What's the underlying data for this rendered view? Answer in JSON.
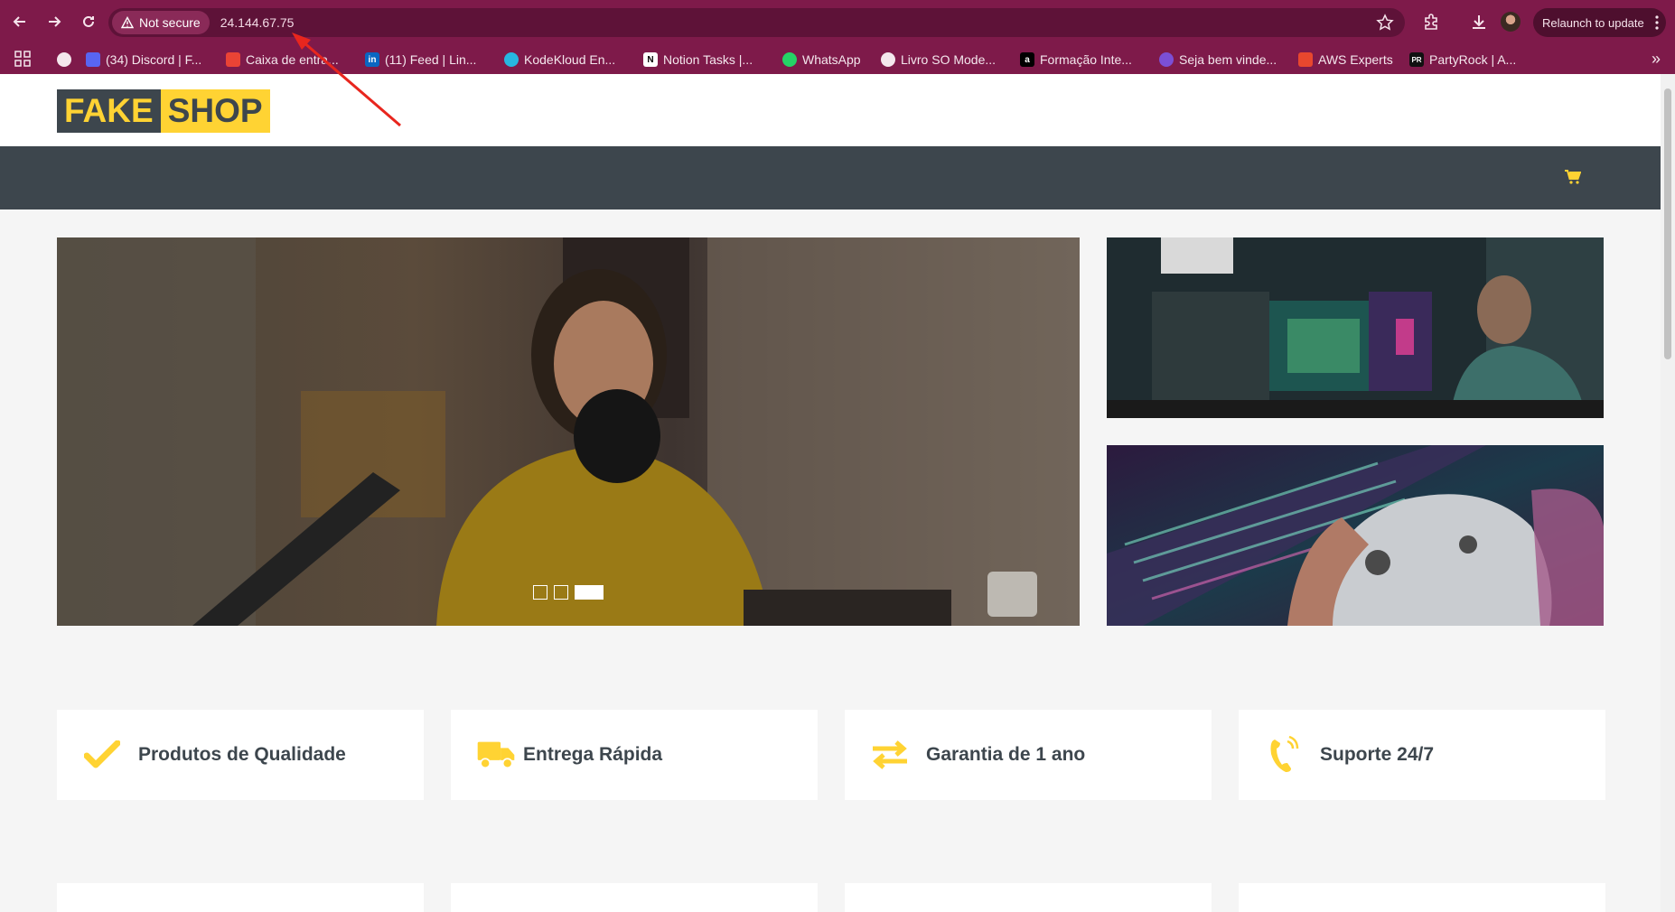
{
  "browser": {
    "security_label": "Not secure",
    "url": "24.144.67.75",
    "relaunch_label": "Relaunch to update",
    "bookmarks": [
      {
        "label": "(34) Discord | F...",
        "icon": "discord-icon",
        "color": "#5865f2"
      },
      {
        "label": "Caixa de entra...",
        "icon": "gmail-icon",
        "color": "#ea4335"
      },
      {
        "label": "(11) Feed | Lin...",
        "icon": "linkedin-icon",
        "color": "#0a66c2"
      },
      {
        "label": "KodeKloud En...",
        "icon": "kodekloud-icon",
        "color": "#27b6e0"
      },
      {
        "label": "Notion Tasks |...",
        "icon": "notion-icon",
        "color": "#ffffff"
      },
      {
        "label": "WhatsApp",
        "icon": "whatsapp-icon",
        "color": "#25d366"
      },
      {
        "label": "Livro SO Mode...",
        "icon": "globe-icon",
        "color": "#ffffff"
      },
      {
        "label": "Formação Inte...",
        "icon": "alura-icon",
        "color": "#000000"
      },
      {
        "label": "Seja bem vinde...",
        "icon": "portal-icon",
        "color": "#7b4fd6"
      },
      {
        "label": "AWS Experts",
        "icon": "aws-icon",
        "color": "#e8472e"
      },
      {
        "label": "PartyRock | A...",
        "icon": "partyrock-icon",
        "color": "#111111"
      }
    ],
    "chrome_color": "#7e1a4a"
  },
  "shop": {
    "logo_part1": "FAKE",
    "logo_part2": "SHOP",
    "accent_color": "#ffd333",
    "dark_color": "#3d464d",
    "cart_icon": "cart-icon",
    "carousel_slides": 3,
    "carousel_active": 3,
    "features": [
      {
        "icon": "check-icon",
        "label": "Produtos de Qualidade"
      },
      {
        "icon": "truck-icon",
        "label": "Entrega Rápida"
      },
      {
        "icon": "exchange-icon",
        "label": "Garantia de 1 ano"
      },
      {
        "icon": "phone-icon",
        "label": "Suporte 24/7"
      }
    ]
  }
}
